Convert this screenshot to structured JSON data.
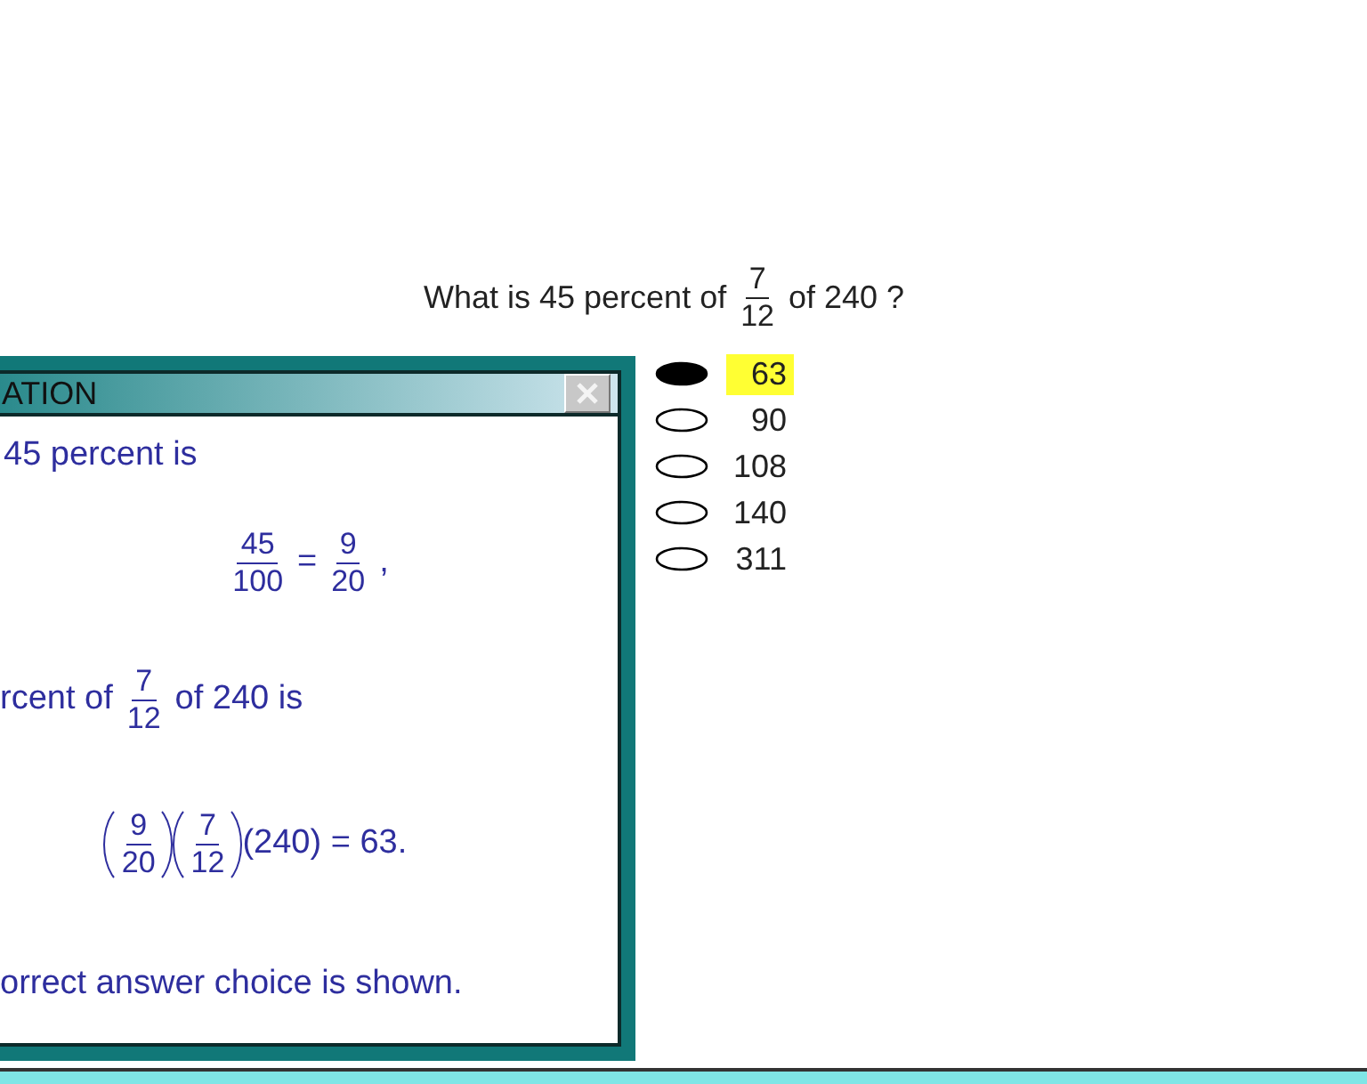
{
  "question": [
    {
      "kind": "text",
      "text": "What is 45 percent of"
    },
    {
      "kind": "fraction",
      "numerator": "7",
      "denominator": "12"
    },
    {
      "kind": "text",
      "text": "of 240 ?"
    }
  ],
  "choices": [
    {
      "label": "63",
      "selected": true,
      "highlighted": true
    },
    {
      "label": "90",
      "selected": false,
      "highlighted": false
    },
    {
      "label": "108",
      "selected": false,
      "highlighted": false
    },
    {
      "label": "140",
      "selected": false,
      "highlighted": false
    },
    {
      "label": "311",
      "selected": false,
      "highlighted": false
    }
  ],
  "explanation_window": {
    "title": "ATION",
    "lines": [
      {
        "segments": [
          {
            "kind": "text",
            "text": "45 percent is"
          }
        ]
      },
      {
        "segments": [
          {
            "kind": "fraction",
            "numerator": "45",
            "denominator": "100"
          },
          {
            "kind": "text",
            "text": "="
          },
          {
            "kind": "fraction",
            "numerator": "9",
            "denominator": "20"
          },
          {
            "kind": "text",
            "text": ","
          }
        ]
      },
      {
        "segments": [
          {
            "kind": "text",
            "text": "rcent of"
          },
          {
            "kind": "fraction",
            "numerator": "7",
            "denominator": "12"
          },
          {
            "kind": "text",
            "text": "of 240 is"
          }
        ]
      },
      {
        "segments": [
          {
            "kind": "paren_fraction",
            "numerator": "9",
            "denominator": "20"
          },
          {
            "kind": "paren_fraction",
            "numerator": "7",
            "denominator": "12"
          },
          {
            "kind": "text",
            "text": "(240) = 63."
          }
        ]
      },
      {
        "segments": [
          {
            "kind": "text",
            "text": "orrect answer choice is shown."
          }
        ]
      }
    ]
  }
}
